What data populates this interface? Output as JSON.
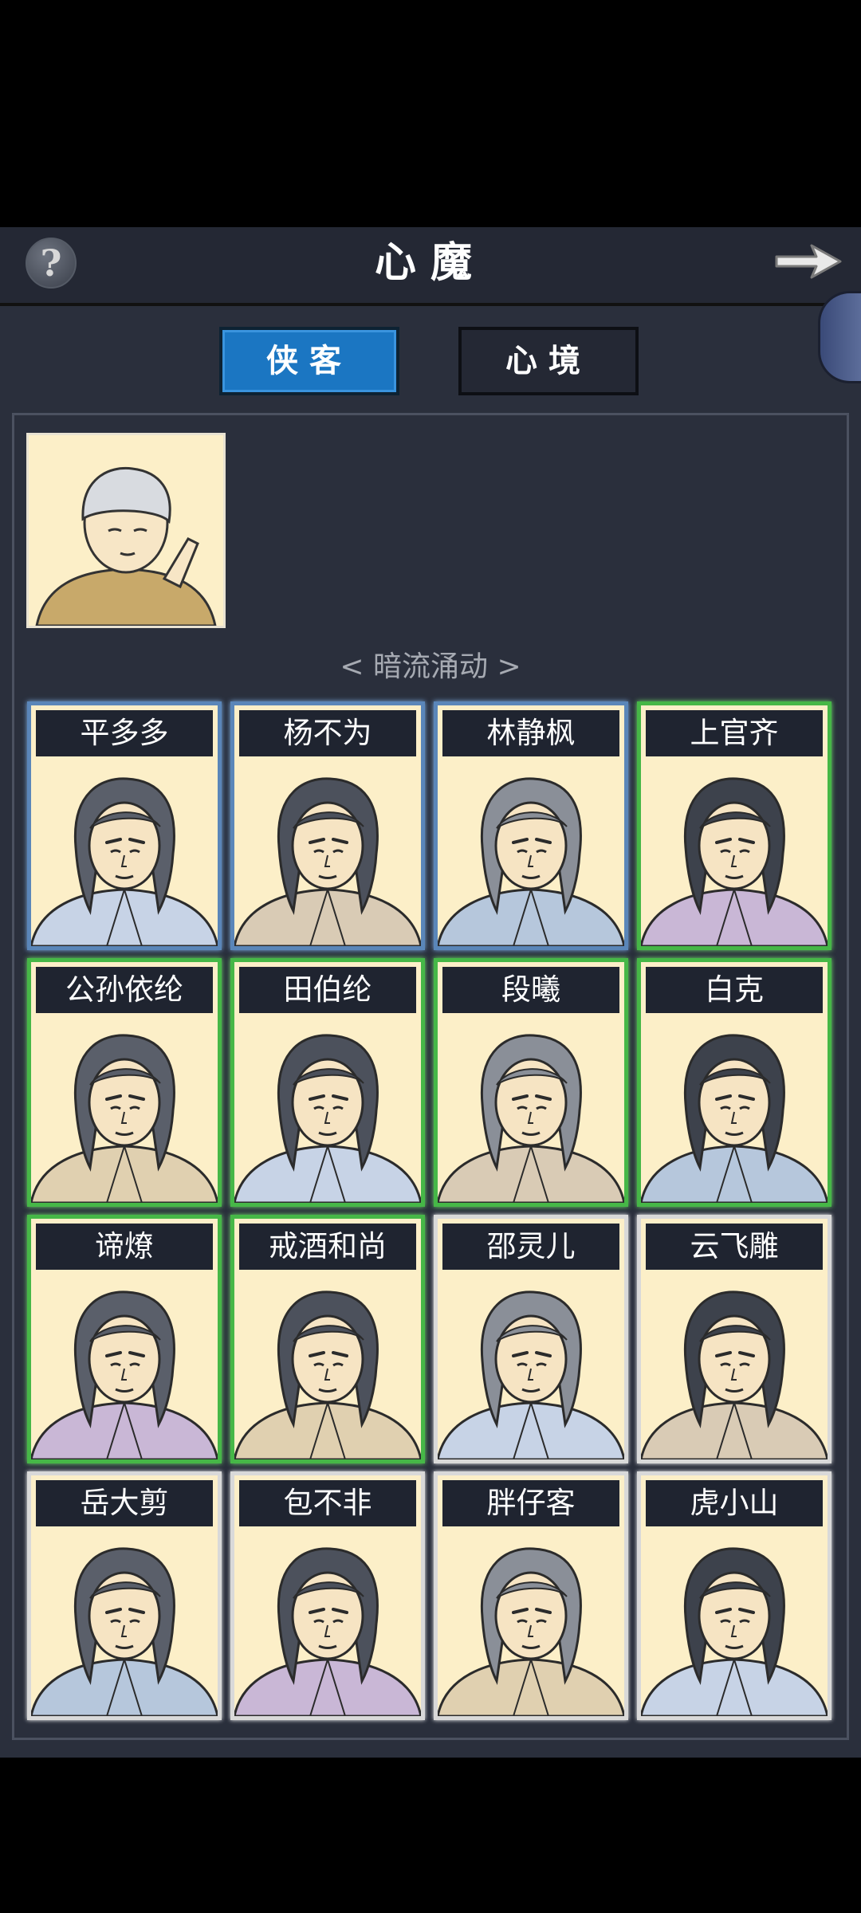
{
  "header": {
    "title": "心魔",
    "help_icon": "question-icon",
    "back_icon": "arrow-right-icon"
  },
  "tabs": [
    {
      "label": "侠客",
      "active": true
    },
    {
      "label": "心境",
      "active": false
    }
  ],
  "section_label": "< 暗流涌动 >",
  "colors": {
    "tab_active": "#1b76c2",
    "card_blue": "#5a86b9",
    "card_green": "#46b747",
    "card_white": "#d9d9d9",
    "card_bg": "#fcefc8"
  },
  "characters": [
    {
      "name": "平多多",
      "tier": "blue"
    },
    {
      "name": "杨不为",
      "tier": "blue"
    },
    {
      "name": "林静枫",
      "tier": "blue"
    },
    {
      "name": "上官齐",
      "tier": "green"
    },
    {
      "name": "公孙依纶",
      "tier": "green"
    },
    {
      "name": "田伯纶",
      "tier": "green"
    },
    {
      "name": "段曦",
      "tier": "green"
    },
    {
      "name": "白克",
      "tier": "green"
    },
    {
      "name": "谛燎",
      "tier": "green"
    },
    {
      "name": "戒酒和尚",
      "tier": "green"
    },
    {
      "name": "邵灵儿",
      "tier": "white"
    },
    {
      "name": "云飞雕",
      "tier": "white"
    },
    {
      "name": "岳大剪",
      "tier": "white"
    },
    {
      "name": "包不非",
      "tier": "white"
    },
    {
      "name": "胖仔客",
      "tier": "white"
    },
    {
      "name": "虎小山",
      "tier": "white"
    }
  ]
}
